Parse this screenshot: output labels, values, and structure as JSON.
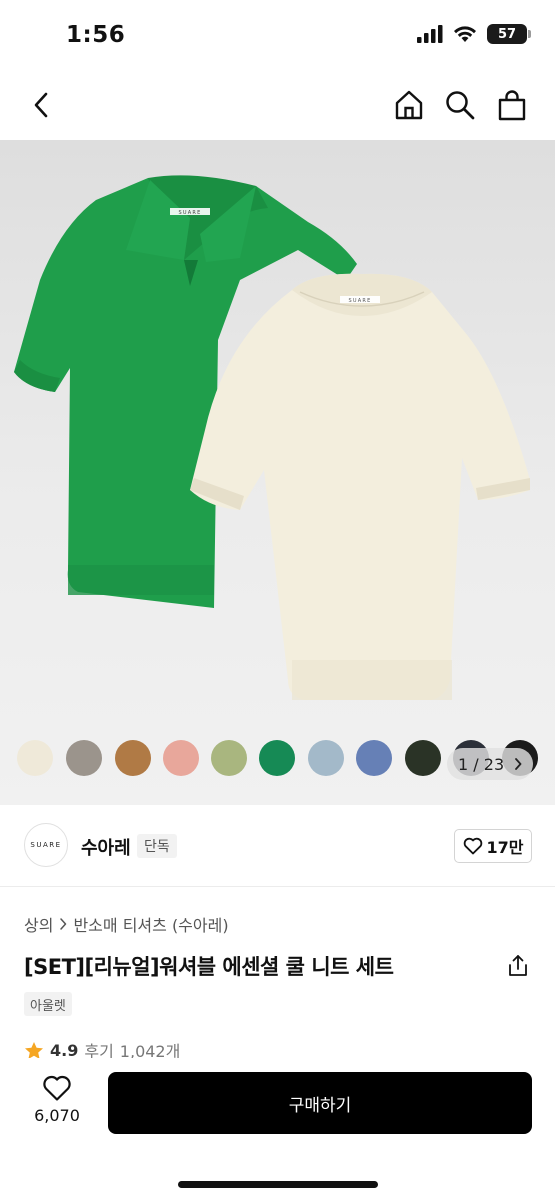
{
  "status_bar": {
    "time": "1:56",
    "battery": "57"
  },
  "nav": {
    "back_icon": "chevron-left-icon",
    "home_icon": "home-icon",
    "search_icon": "search-icon",
    "cart_icon": "shopping-bag-icon"
  },
  "gallery": {
    "shirt_label": "SUARE",
    "swatch_colors": [
      "#efe9d9",
      "#9b948c",
      "#b07a45",
      "#e8a79b",
      "#a9b67f",
      "#168a55",
      "#a3b9c9",
      "#6680b6",
      "#2a3326",
      "#2c3039",
      "#1b1b1b"
    ],
    "page_current": "1",
    "page_total": "23",
    "page_separator": "/",
    "next_icon": "chevron-right-icon"
  },
  "brand": {
    "logo_text": "SUARE",
    "name": "수아레",
    "badge": "단독",
    "likes": "17만"
  },
  "product": {
    "breadcrumb_1": "상의",
    "breadcrumb_2": "반소매 티셔츠 (수아레)",
    "title": "[SET][리뉴얼]워셔블 에센셜 쿨 니트 세트",
    "tag": "아울렛",
    "rating": "4.9",
    "review_label": "후기",
    "review_count": "1,042개"
  },
  "bottom_bar": {
    "wishlist_count": "6,070",
    "buy_label": "구매하기"
  },
  "colors": {
    "green_shirt": "#1f9e4b",
    "cream_shirt": "#f3eedd",
    "star": "#f5a623",
    "buy_button": "#000000"
  }
}
